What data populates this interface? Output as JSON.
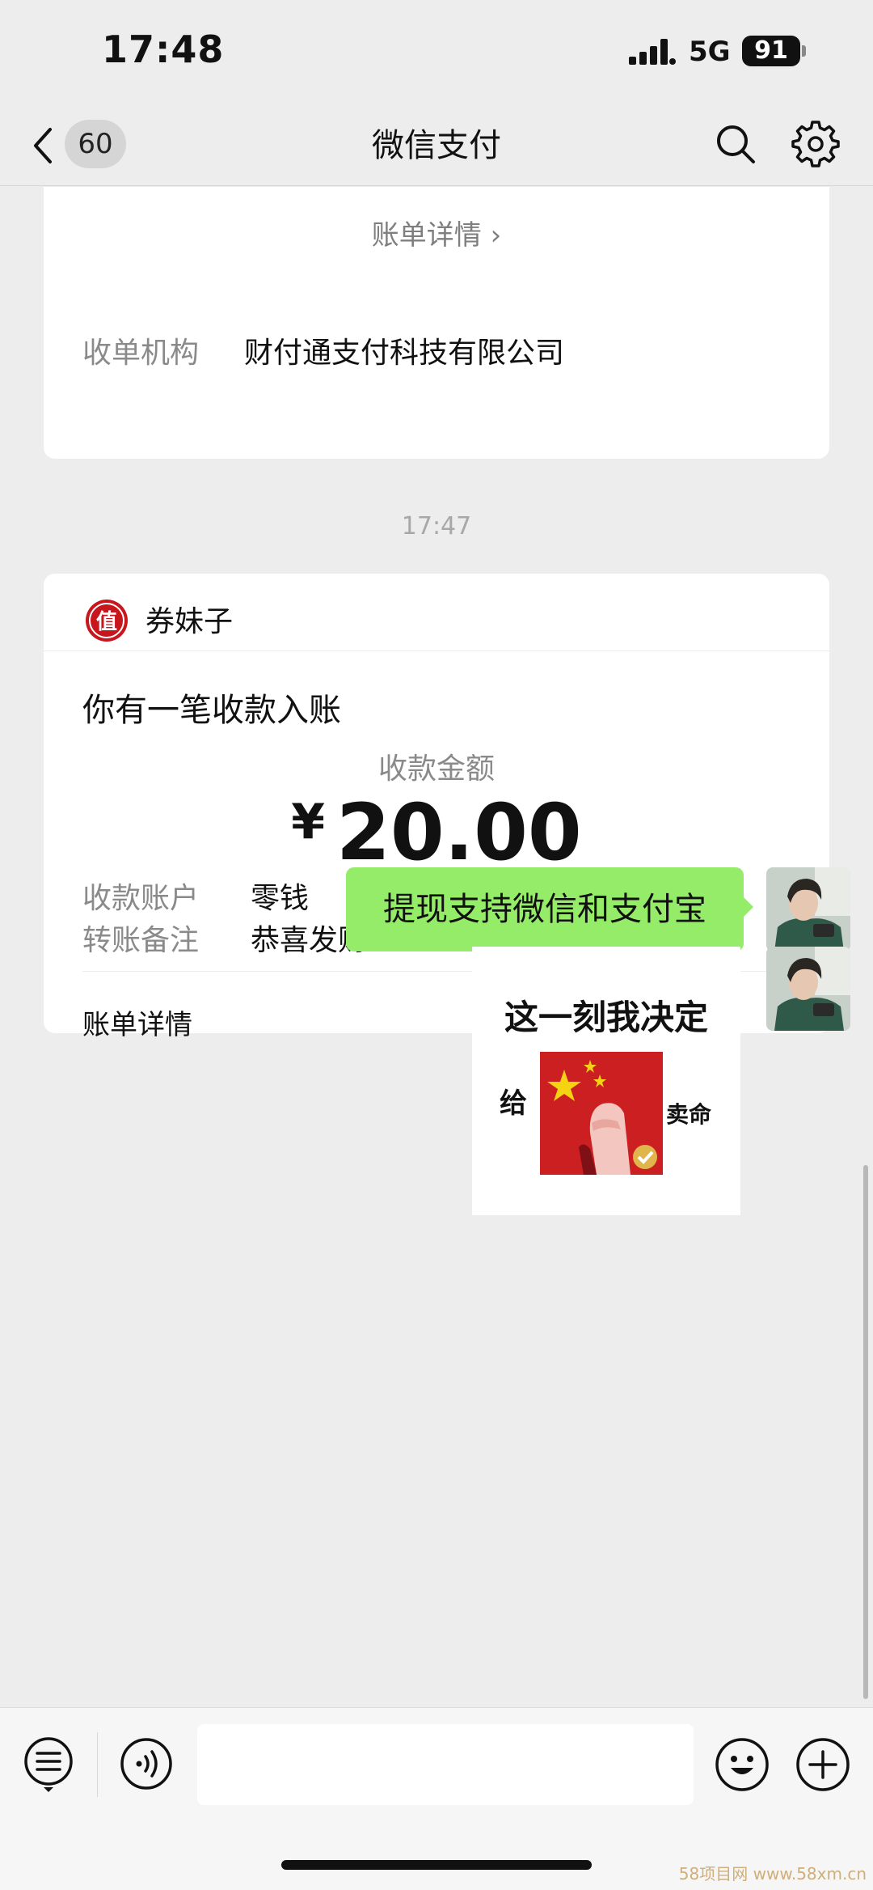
{
  "status_bar": {
    "time": "17:48",
    "network": "5G",
    "battery": "91"
  },
  "nav": {
    "back_count": "60",
    "title": "微信支付"
  },
  "top_card": {
    "detail_link": "账单详情 ›",
    "org_label": "收单机构",
    "org_value": "财付通支付科技有限公司"
  },
  "timestamp": "17:47",
  "payment_card": {
    "sender": "券妹子",
    "notice": "你有一笔收款入账",
    "amount_label": "收款金额",
    "currency": "¥",
    "amount": "20.00",
    "rows": [
      {
        "label": "收款账户",
        "value": "零钱"
      },
      {
        "label": "转账备注",
        "value": "恭喜发财"
      }
    ],
    "bill_link": "账单详情"
  },
  "messages": {
    "text": "提现支持微信和支付宝",
    "sticker": {
      "line1": "这一刻我决定",
      "left": "给",
      "right": "卖命"
    }
  },
  "input": {
    "placeholder": ""
  },
  "watermark": "58项目网 www.58xm.cn"
}
